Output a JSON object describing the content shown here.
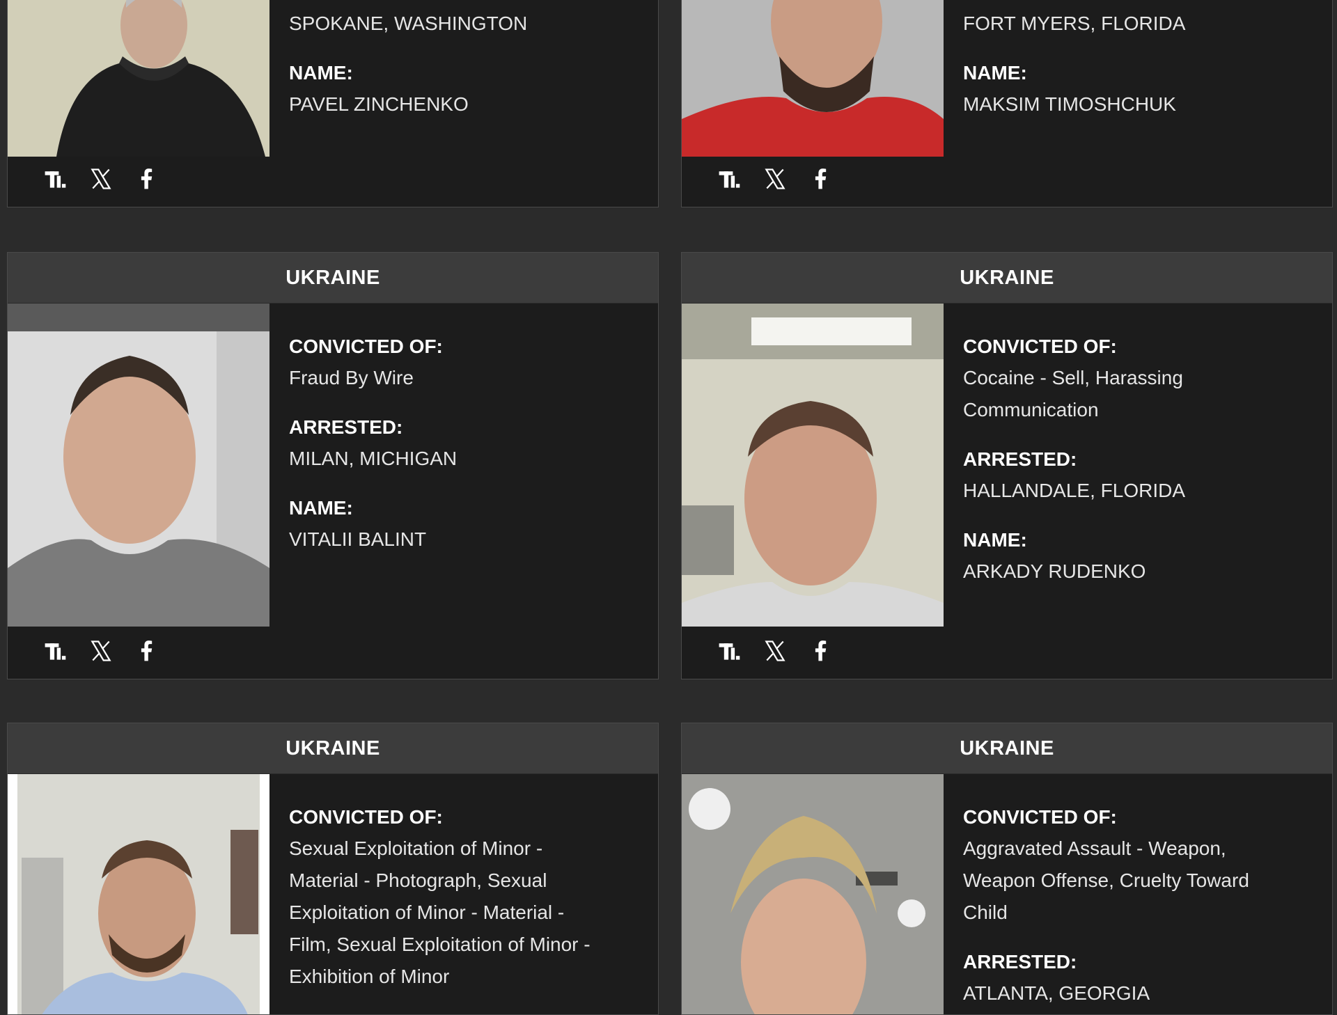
{
  "cards": [
    {
      "header": "",
      "arrested_value": "SPOKANE, WASHINGTON",
      "name_label": "NAME:",
      "name_value": "PAVEL ZINCHENKO",
      "share": [
        "truth-social-icon",
        "x-icon",
        "facebook-icon"
      ]
    },
    {
      "header": "",
      "arrested_value": "FORT MYERS, FLORIDA",
      "name_label": "NAME:",
      "name_value": "MAKSIM TIMOSHCHUK",
      "share": [
        "truth-social-icon",
        "x-icon",
        "facebook-icon"
      ]
    },
    {
      "header": "UKRAINE",
      "convicted_label": "CONVICTED OF:",
      "convicted_value": "Fraud By Wire",
      "arrested_label": "ARRESTED:",
      "arrested_value": "MILAN, MICHIGAN",
      "name_label": "NAME:",
      "name_value": "VITALII BALINT",
      "share": [
        "truth-social-icon",
        "x-icon",
        "facebook-icon"
      ]
    },
    {
      "header": "UKRAINE",
      "convicted_label": "CONVICTED OF:",
      "convicted_value": "Cocaine - Sell, Harassing Communication",
      "arrested_label": "ARRESTED:",
      "arrested_value": "HALLANDALE, FLORIDA",
      "name_label": "NAME:",
      "name_value": "ARKADY RUDENKO",
      "share": [
        "truth-social-icon",
        "x-icon",
        "facebook-icon"
      ]
    },
    {
      "header": "UKRAINE",
      "convicted_label": "CONVICTED OF:",
      "convicted_value": "Sexual Exploitation of Minor - Material - Photograph, Sexual Exploitation of Minor - Material - Film, Sexual Exploitation of Minor - Exhibition of Minor"
    },
    {
      "header": "UKRAINE",
      "convicted_label": "CONVICTED OF:",
      "convicted_value": "Aggravated Assault - Weapon, Weapon Offense, Cruelty Toward Child",
      "arrested_label": "ARRESTED:",
      "arrested_value": "ATLANTA, GEORGIA"
    }
  ],
  "colors": {
    "page_bg": "#2b2b2b",
    "card_bg": "#1c1c1c",
    "header_bg": "#3c3c3c",
    "text": "#ffffff"
  }
}
